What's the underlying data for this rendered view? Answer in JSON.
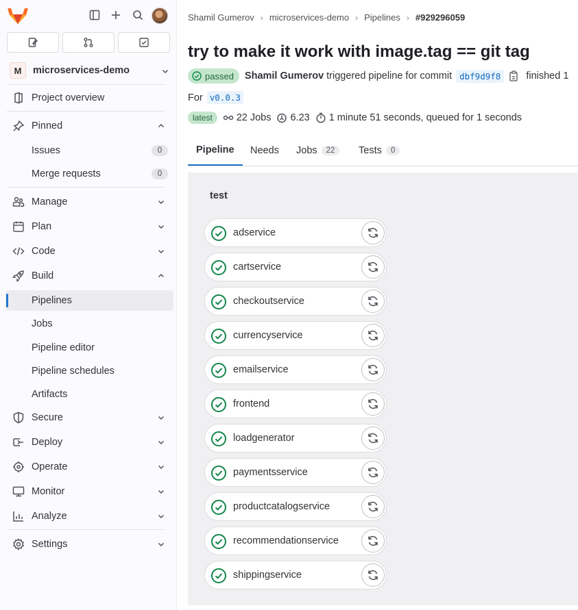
{
  "sidebar": {
    "project_initial": "M",
    "project_name": "microservices-demo",
    "items": [
      {
        "label": "Project overview"
      },
      {
        "label": "Pinned"
      },
      {
        "label": "Issues",
        "badge": "0"
      },
      {
        "label": "Merge requests",
        "badge": "0"
      },
      {
        "label": "Manage"
      },
      {
        "label": "Plan"
      },
      {
        "label": "Code"
      },
      {
        "label": "Build"
      },
      {
        "label": "Pipelines"
      },
      {
        "label": "Jobs"
      },
      {
        "label": "Pipeline editor"
      },
      {
        "label": "Pipeline schedules"
      },
      {
        "label": "Artifacts"
      },
      {
        "label": "Secure"
      },
      {
        "label": "Deploy"
      },
      {
        "label": "Operate"
      },
      {
        "label": "Monitor"
      },
      {
        "label": "Analyze"
      },
      {
        "label": "Settings"
      }
    ]
  },
  "breadcrumb": [
    "Shamil Gumerov",
    "microservices-demo",
    "Pipelines",
    "#929296059"
  ],
  "pipeline": {
    "title": "try to make it work with image.tag == git tag",
    "status": "passed",
    "author": "Shamil Gumerov",
    "trigger_text": "triggered pipeline for commit",
    "commit_sha": "dbf9d9f8",
    "finished_text": "finished 1",
    "for_label": "For",
    "ref": "v0.0.3",
    "latest_badge": "latest",
    "jobs_text": "22 Jobs",
    "score_text": "6.23",
    "duration_text": "1 minute 51 seconds, queued for 1 seconds"
  },
  "tabs": [
    {
      "label": "Pipeline"
    },
    {
      "label": "Needs"
    },
    {
      "label": "Jobs",
      "count": "22"
    },
    {
      "label": "Tests",
      "count": "0"
    }
  ],
  "stage": {
    "name": "test",
    "jobs": [
      "adservice",
      "cartservice",
      "checkoutservice",
      "currencyservice",
      "emailservice",
      "frontend",
      "loadgenerator",
      "paymentsservice",
      "productcatalogservice",
      "recommendationservice",
      "shippingservice"
    ]
  },
  "colors": {
    "accent": "#1f75cb",
    "success": "#108548",
    "success_bg": "#c3e6cd"
  }
}
